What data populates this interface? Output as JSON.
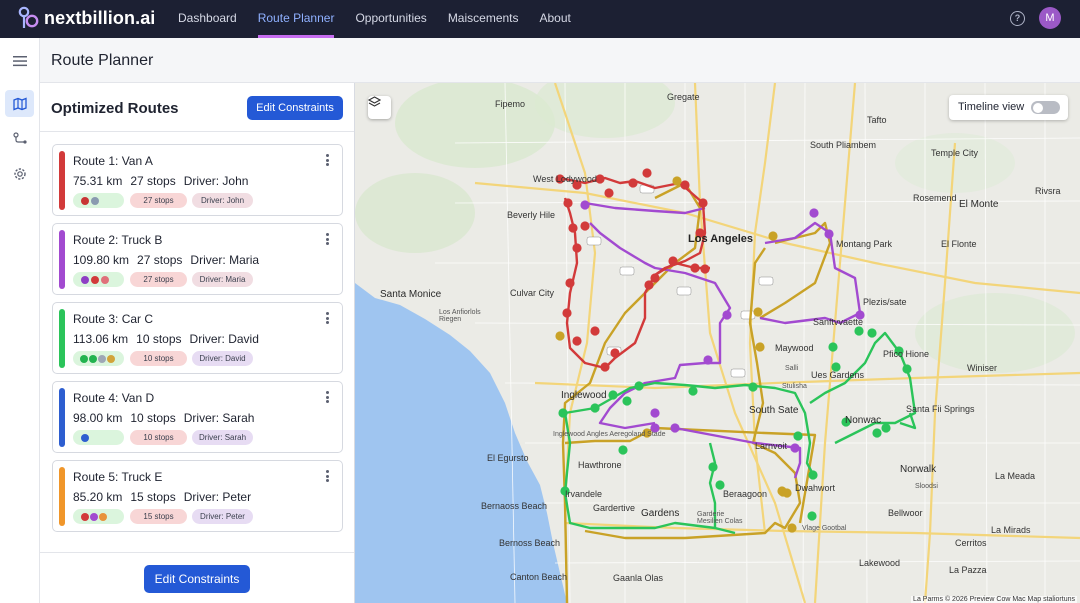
{
  "brand": {
    "name": "nextbillion.ai"
  },
  "nav": {
    "items": [
      {
        "label": "Dashboard"
      },
      {
        "label": "Route Planner"
      },
      {
        "label": "Opportunities"
      },
      {
        "label": "Maiscements"
      },
      {
        "label": "About"
      }
    ],
    "active_index": 1,
    "help_label": "?",
    "avatar_initial": "M"
  },
  "rail": {
    "icons": [
      "menu-icon",
      "map-icon",
      "route-icon",
      "settings-icon"
    ]
  },
  "page": {
    "title": "Route Planner"
  },
  "panel": {
    "title": "Optimized Routes",
    "edit_top_label": "Edit Constraints",
    "edit_bottom_label": "Edit Constraints",
    "routes": [
      {
        "title": "Route 1: Van A",
        "distance": "75.31 km",
        "stops": "27 stops",
        "driver": "Driver: John",
        "stops_pill": "27 stops",
        "driver_pill": "Driver: John",
        "color": "#d23a3a",
        "dots": [
          "#c83434",
          "#8a9ab0"
        ]
      },
      {
        "title": "Route 2: Truck B",
        "distance": "109.80 km",
        "stops": "27 stops",
        "driver": "Driver: Maria",
        "stops_pill": "27 stops",
        "driver_pill": "Driver: Maria",
        "color": "#a24ad0",
        "dots": [
          "#8e3fc4",
          "#d23a3a",
          "#e0707a"
        ]
      },
      {
        "title": "Route 3: Car C",
        "distance": "113.06 km",
        "stops": "10 stops",
        "driver": "Driver: David",
        "stops_pill": "10 stops",
        "driver_pill": "Driver: David",
        "color": "#2bc45a",
        "dots": [
          "#23b34f",
          "#23b34f",
          "#9ea7b5",
          "#d2a43a"
        ]
      },
      {
        "title": "Route 4: Van D",
        "distance": "98.00 km",
        "stops": "10 stops",
        "driver": "Driver: Sarah",
        "stops_pill": "10 stops",
        "driver_pill": "Driver: Sarah",
        "color": "#2d5ed0",
        "dots": [
          "#2d5ed0"
        ]
      },
      {
        "title": "Route 5: Truck E",
        "distance": "85.20 km",
        "stops": "15 stops",
        "driver": "Driver: Peter",
        "stops_pill": "15 stops",
        "driver_pill": "Driver: Peter",
        "color": "#f0962a",
        "dots": [
          "#d23a3a",
          "#a24ad0",
          "#e8923a"
        ]
      }
    ]
  },
  "map": {
    "timeline_label": "Timeline view",
    "timeline_on": false,
    "attribution": "La Parms © 2026 Preview Cow Mac Map staliortuns",
    "labels": [
      "Gregate",
      "Fipemo",
      "Tafto",
      "South Pliambem",
      "Temple City",
      "Rivsra",
      "El Monte",
      "West Lodywood",
      "Beverly Hile",
      "Los Angeles",
      "Montang Park",
      "Rosemend",
      "El Flonte",
      "Santa Monice",
      "Culvar City",
      "Los Anfiorlols Riegen",
      "Plezis/sate",
      "Sanftvvaette",
      "Maywood",
      "Pfico Hione",
      "Winiser",
      "Inglewood",
      "Ues Gardens",
      "South Sate",
      "Nonwac",
      "Santa Fii Springs",
      "Inglewood Angles Aeregoland Stade",
      "El Egursto",
      "Hawthrone",
      "Larnvoit",
      "Norwalk",
      "La Meada",
      "Irvandele",
      "Dwahwort",
      "Bernaoss Beach",
      "Gardertive",
      "Beraagoon",
      "Gardens",
      "Bellwoor",
      "La Mirads",
      "Bernoss Beach",
      "Lakewood",
      "Canton Beach",
      "Gaanla Olas",
      "La Pazza",
      "Salli",
      "Stulisha",
      "Garderie Mesilien Colas",
      "Sloodsi",
      "Cerritos",
      "Vlage Gootbal"
    ]
  }
}
